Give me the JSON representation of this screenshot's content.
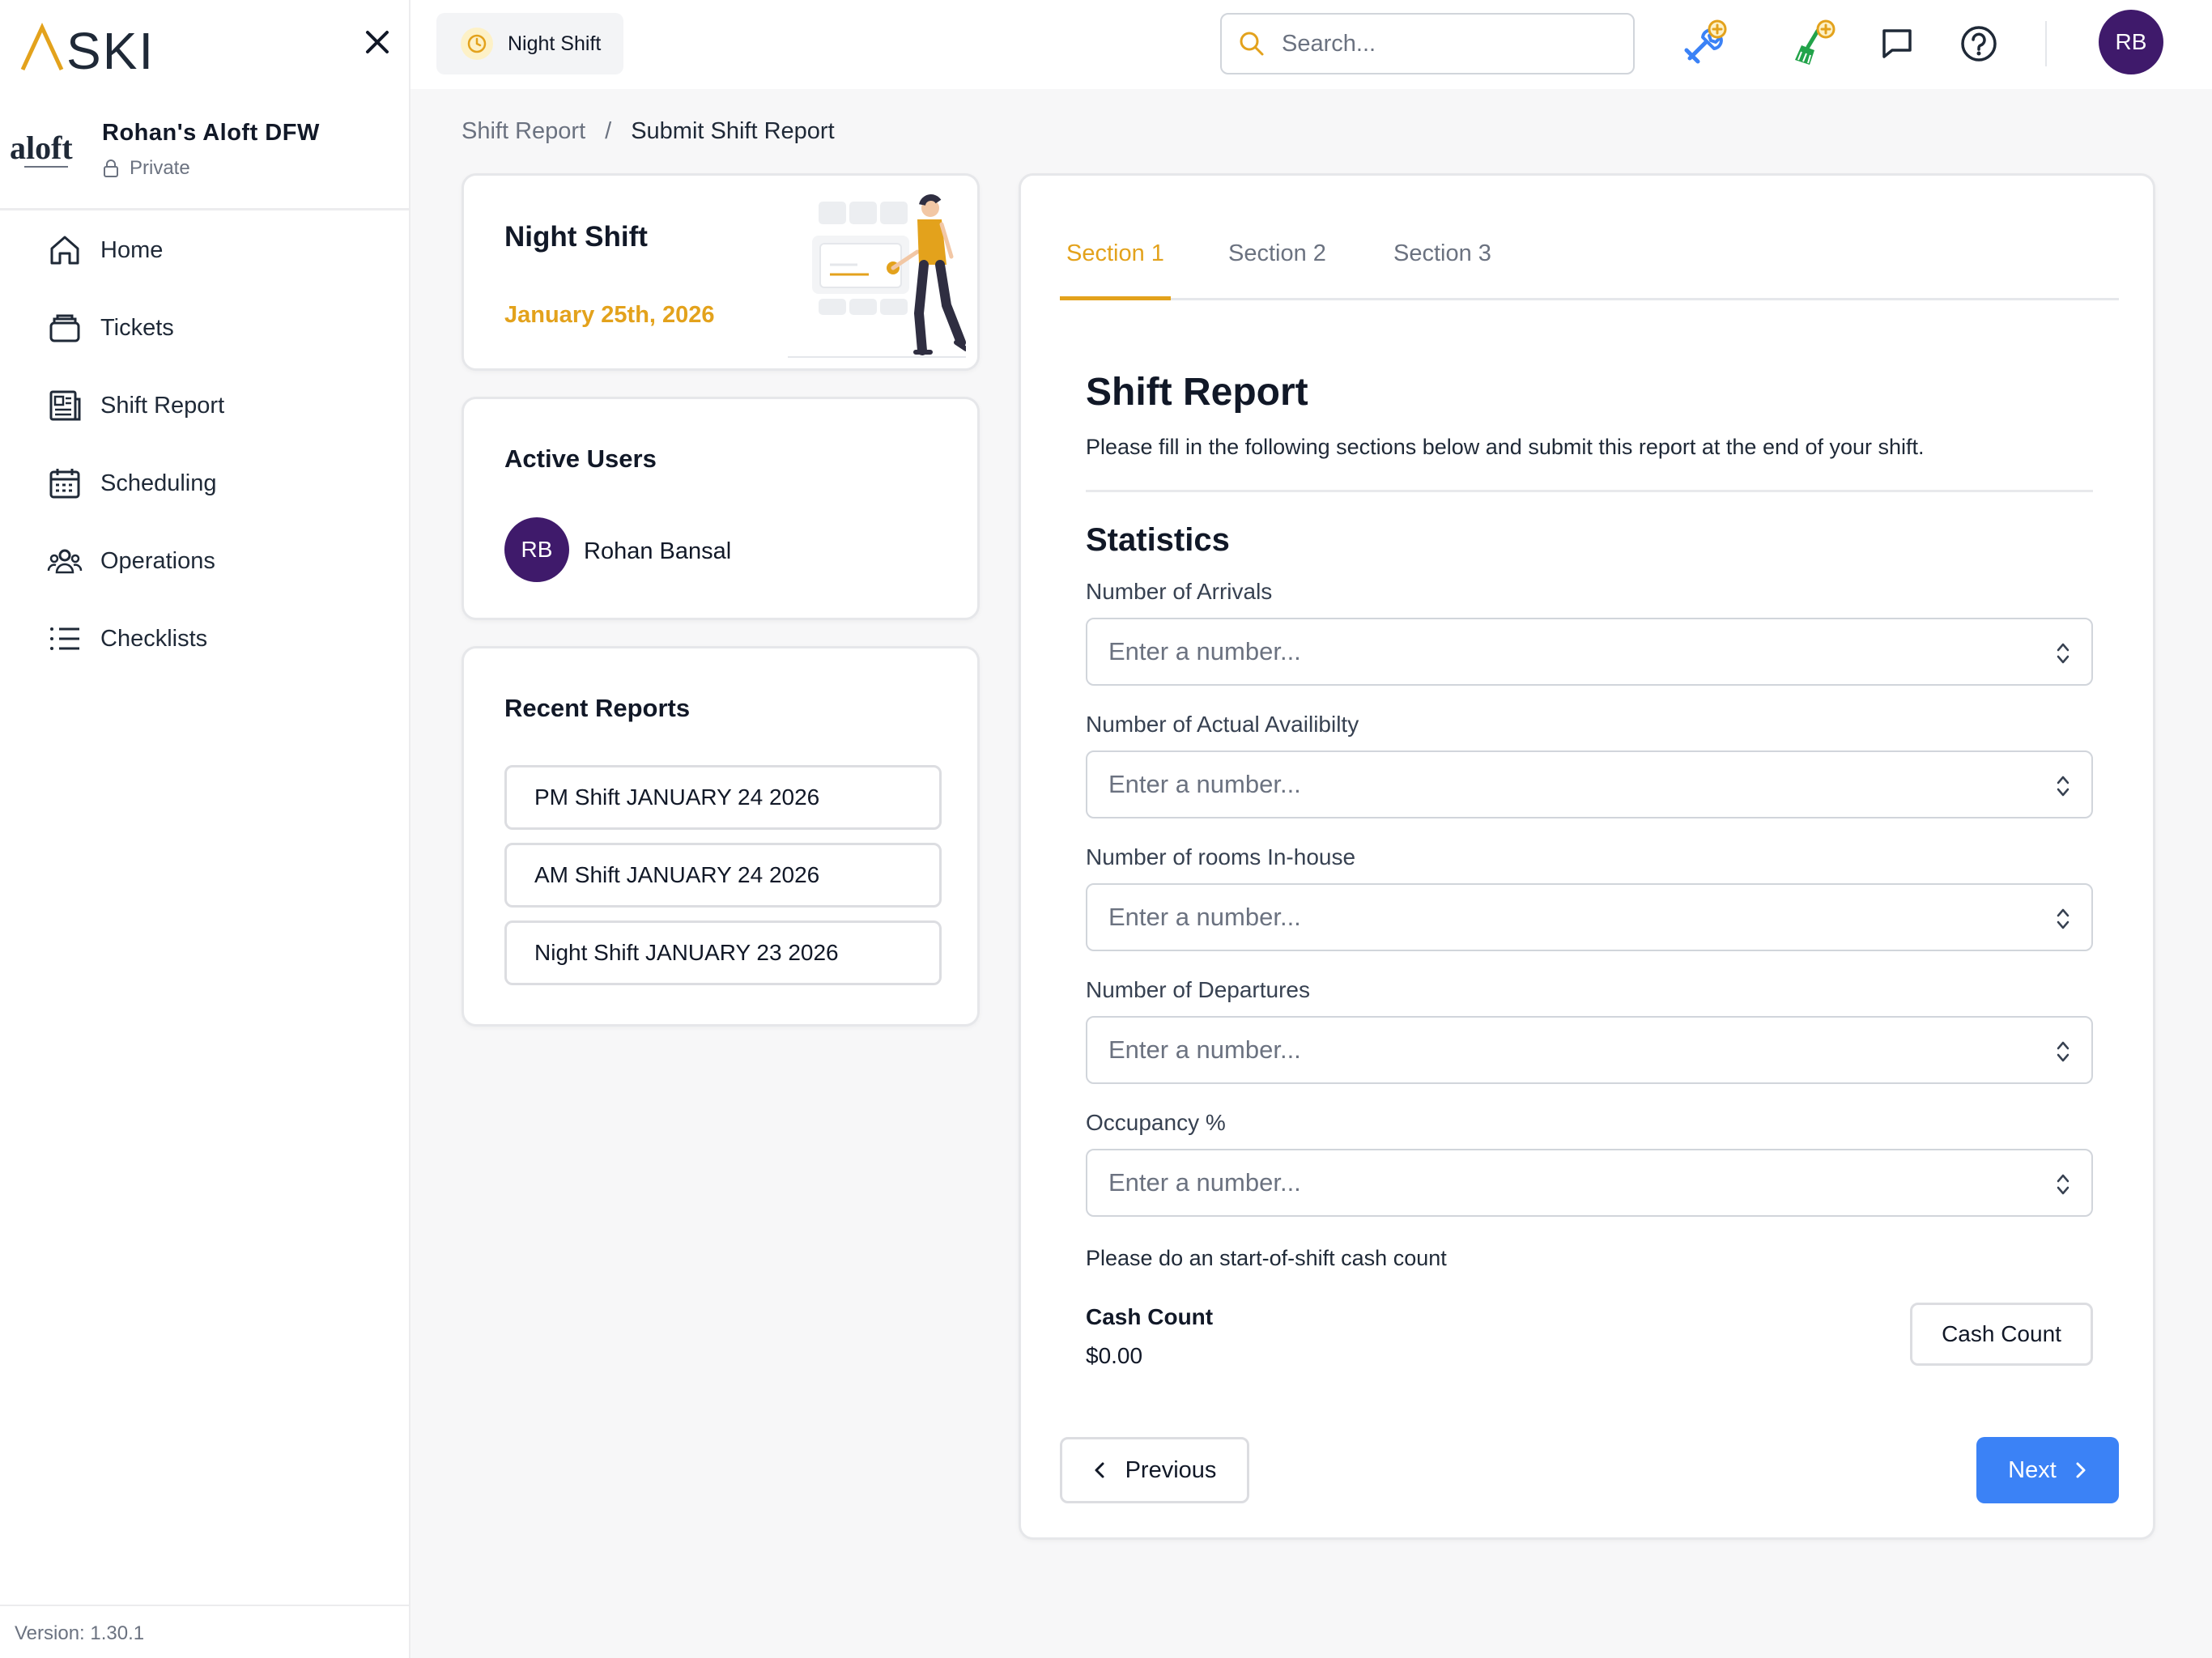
{
  "app": {
    "logo_text": "ASKI",
    "version": "Version: 1.30.1"
  },
  "organization": {
    "name": "Rohan's Aloft DFW",
    "visibility": "Private",
    "logo_text": "aloft"
  },
  "sidebar": {
    "items": [
      {
        "label": "Home",
        "icon": "home-icon"
      },
      {
        "label": "Tickets",
        "icon": "tickets-icon"
      },
      {
        "label": "Shift Report",
        "icon": "report-icon"
      },
      {
        "label": "Scheduling",
        "icon": "calendar-icon"
      },
      {
        "label": "Operations",
        "icon": "people-icon"
      },
      {
        "label": "Checklists",
        "icon": "list-icon"
      }
    ]
  },
  "topbar": {
    "shift_chip": "Night Shift",
    "search_placeholder": "Search...",
    "avatar_initials": "RB",
    "colors": {
      "accent": "#e3a21c",
      "avatar": "#3f1a6b",
      "primary": "#3b82f6",
      "wrench": "#3b82f6",
      "broom": "#22a34a"
    }
  },
  "breadcrumb": {
    "parent": "Shift Report",
    "separator": "/",
    "current": "Submit Shift Report"
  },
  "shift_card": {
    "title": "Night Shift",
    "date": "January 25th, 2026"
  },
  "active_users": {
    "title": "Active Users",
    "users": [
      {
        "initials": "RB",
        "name": "Rohan Bansal"
      }
    ]
  },
  "recent_reports": {
    "title": "Recent Reports",
    "items": [
      "PM Shift JANUARY 24 2026",
      "AM Shift JANUARY 24 2026",
      "Night Shift JANUARY 23 2026"
    ]
  },
  "form": {
    "tabs": [
      "Section 1",
      "Section 2",
      "Section 3"
    ],
    "active_tab": "Section 1",
    "title": "Shift Report",
    "description": "Please fill in the following sections below and submit this report at the end of your shift.",
    "section_title": "Statistics",
    "fields": [
      {
        "label": "Number of Arrivals",
        "placeholder": "Enter a number..."
      },
      {
        "label": "Number of Actual Availibilty",
        "placeholder": "Enter a number..."
      },
      {
        "label": "Number of rooms In-house",
        "placeholder": "Enter a number..."
      },
      {
        "label": "Number of Departures",
        "placeholder": "Enter a number..."
      },
      {
        "label": "Occupancy %",
        "placeholder": "Enter a number..."
      }
    ],
    "cash_note": "Please do an start-of-shift cash count",
    "cash_label": "Cash Count",
    "cash_value": "$0.00",
    "cash_button": "Cash Count",
    "previous_button": "Previous",
    "next_button": "Next"
  }
}
